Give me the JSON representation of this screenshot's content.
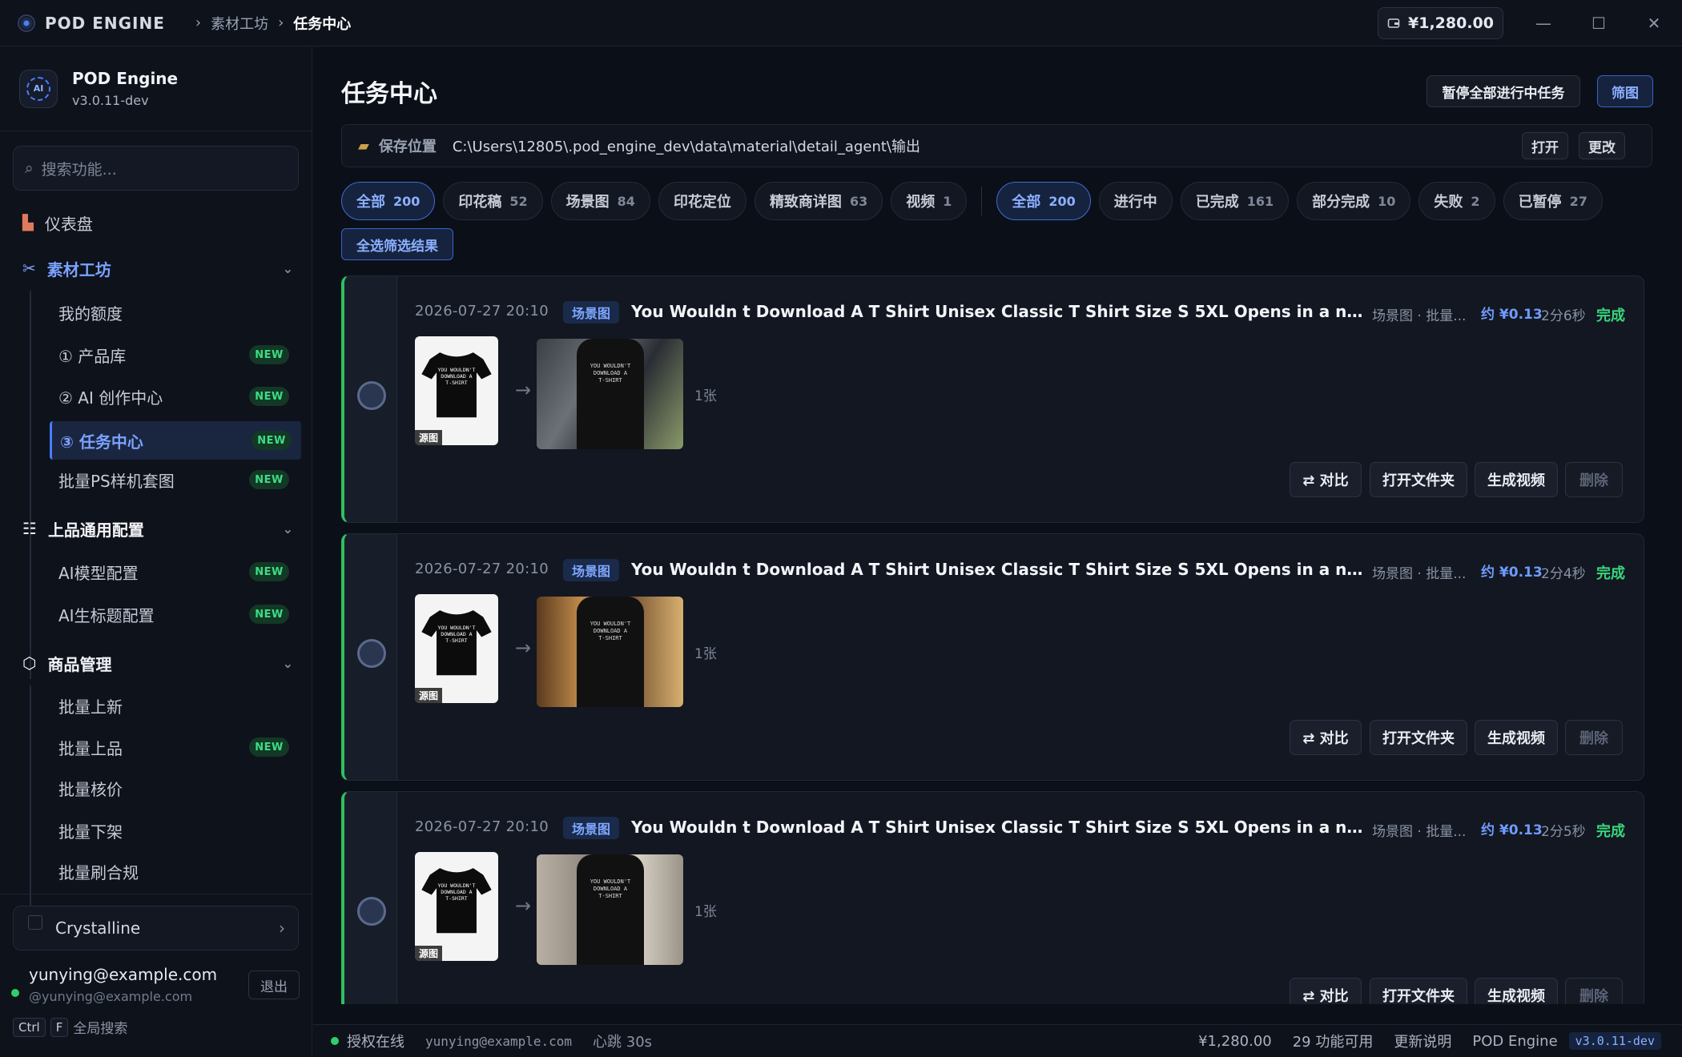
{
  "titlebar": {
    "app_name": "POD ENGINE",
    "breadcrumb": [
      "素材工坊",
      "任务中心"
    ],
    "separator": "›",
    "wallet": "¥1,280.00",
    "minimize": "—",
    "maximize": "☐",
    "close": "✕"
  },
  "sidebar": {
    "app_title": "POD Engine",
    "version": "v3.0.11-dev",
    "logo_text": "AI",
    "search_placeholder": "搜索功能...",
    "dashboard": "仪表盘",
    "groups": [
      {
        "label": "素材工坊",
        "items": [
          {
            "label": "我的额度",
            "new": false
          },
          {
            "label": "① 产品库",
            "new": true
          },
          {
            "label": "② AI 创作中心",
            "new": true
          },
          {
            "label": "③ 任务中心",
            "new": true
          },
          {
            "label": "批量PS样机套图",
            "new": true
          }
        ]
      },
      {
        "label": "上品通用配置",
        "items": [
          {
            "label": "AI模型配置",
            "new": true
          },
          {
            "label": "AI生标题配置",
            "new": true
          }
        ]
      },
      {
        "label": "商品管理",
        "items": [
          {
            "label": "批量上新",
            "new": false
          },
          {
            "label": "批量上品",
            "new": true
          },
          {
            "label": "批量核价",
            "new": false
          },
          {
            "label": "批量下架",
            "new": false
          },
          {
            "label": "批量刷合规",
            "new": false
          }
        ]
      }
    ],
    "new_badge": "NEW",
    "workspace": "Crystalline",
    "user_email": "yunying@example.com",
    "user_handle": "@yunying@example.com",
    "logout": "退出",
    "kbd_ctrl": "Ctrl",
    "kbd_f": "F",
    "kbd_hint": "全局搜索"
  },
  "main": {
    "title": "任务中心",
    "pause_all": "暂停全部进行中任务",
    "filter": "筛图",
    "save_label": "保存位置",
    "save_path": "C:\\Users\\12805\\.pod_engine_dev\\data\\material\\detail_agent\\输出",
    "open": "打开",
    "change": "更改",
    "type_chips": [
      {
        "label": "全部",
        "count": "200",
        "active": true
      },
      {
        "label": "印花稿",
        "count": "52",
        "active": false
      },
      {
        "label": "场景图",
        "count": "84",
        "active": false
      },
      {
        "label": "印花定位",
        "count": "",
        "active": false
      },
      {
        "label": "精致商详图",
        "count": "63",
        "active": false
      },
      {
        "label": "视频",
        "count": "1",
        "active": false
      }
    ],
    "status_chips": [
      {
        "label": "全部",
        "count": "200",
        "active": true
      },
      {
        "label": "进行中",
        "count": "",
        "active": false
      },
      {
        "label": "已完成",
        "count": "161",
        "active": false
      },
      {
        "label": "部分完成",
        "count": "10",
        "active": false
      },
      {
        "label": "失败",
        "count": "2",
        "active": false
      },
      {
        "label": "已暂停",
        "count": "27",
        "active": false
      }
    ],
    "select_all": "全选筛选结果",
    "tasks": [
      {
        "date": "2026-07-27 20:10",
        "tag": "场景图",
        "title": "You Wouldn t Download A T Shirt Unisex Classic T Shirt Size S 5XL Opens in a new window...",
        "meta": "场景图 · 批量...",
        "cost": "约 ¥0.13",
        "duration": "2分6秒",
        "status": "完成",
        "count": "1张",
        "src_label": "源图",
        "scene": "street"
      },
      {
        "date": "2026-07-27 20:10",
        "tag": "场景图",
        "title": "You Wouldn t Download A T Shirt Unisex Classic T Shirt Size S 5XL Opens in a new window...",
        "meta": "场景图 · 批量...",
        "cost": "约 ¥0.13",
        "duration": "2分4秒",
        "status": "完成",
        "count": "1张",
        "src_label": "源图",
        "scene": "japanese-room"
      },
      {
        "date": "2026-07-27 20:10",
        "tag": "场景图",
        "title": "You Wouldn t Download A T Shirt Unisex Classic T Shirt Size S 5XL Opens in a new window...",
        "meta": "场景图 · 批量...",
        "cost": "约 ¥0.13",
        "duration": "2分5秒",
        "status": "完成",
        "count": "1张",
        "src_label": "源图",
        "scene": "city"
      }
    ],
    "actions": {
      "compare": "⇄ 对比",
      "open_folder": "打开文件夹",
      "gen_video": "生成视频",
      "delete": "删除"
    },
    "shirt_text": [
      "YOU WOULDN'T",
      "DOWNLOAD A",
      "T-SHIRT"
    ]
  },
  "statusbar": {
    "auth": "授权在线",
    "user": "yunying@example.com",
    "heartbeat": "心跳 30s",
    "balance": "¥1,280.00",
    "features": "29 功能可用",
    "changelog": "更新说明",
    "product": "POD Engine",
    "version": "v3.0.11-dev"
  }
}
